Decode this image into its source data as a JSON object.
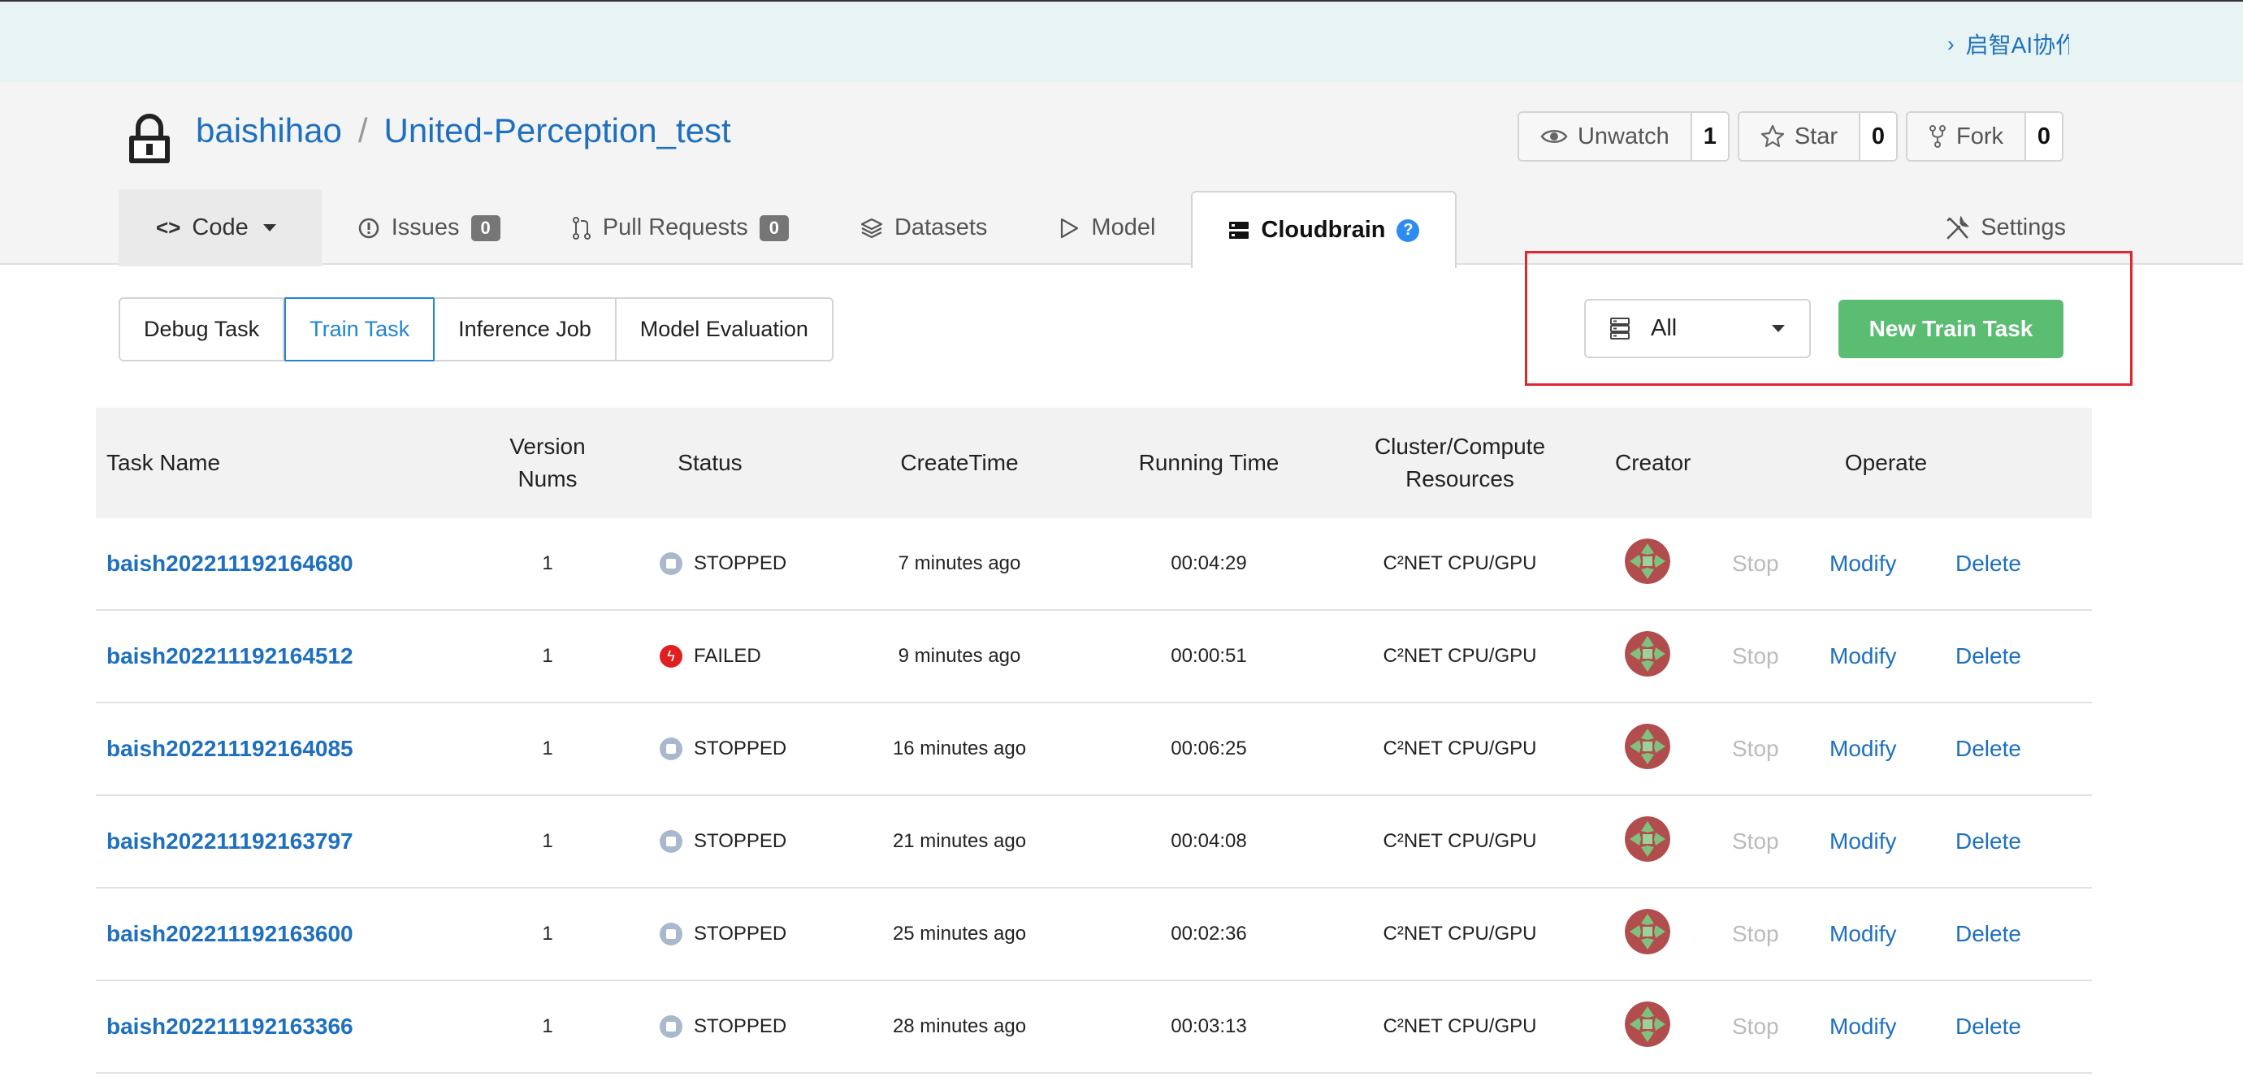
{
  "banner": {
    "link_text": "启智AI协作平台"
  },
  "repo": {
    "owner": "baishihao",
    "separator": "/",
    "name": "United-Perception_test"
  },
  "actions": {
    "watch": {
      "label": "Unwatch",
      "count": "1"
    },
    "star": {
      "label": "Star",
      "count": "0"
    },
    "fork": {
      "label": "Fork",
      "count": "0"
    }
  },
  "tabs": {
    "code": "Code",
    "issues": {
      "label": "Issues",
      "count": "0"
    },
    "pulls": {
      "label": "Pull Requests",
      "count": "0"
    },
    "datasets": "Datasets",
    "model": "Model",
    "cloudbrain": "Cloudbrain",
    "help": "?",
    "settings": "Settings"
  },
  "subtabs": [
    "Debug Task",
    "Train Task",
    "Inference Job",
    "Model Evaluation"
  ],
  "filter": {
    "selected": "All"
  },
  "new_task_label": "New Train Task",
  "table": {
    "headers": {
      "name": "Task Name",
      "version_1": "Version",
      "version_2": "Nums",
      "status": "Status",
      "create": "CreateTime",
      "running": "Running Time",
      "cluster_1": "Cluster/Compute",
      "cluster_2": "Resources",
      "creator": "Creator",
      "operate": "Operate"
    },
    "rows": [
      {
        "name": "baish202211192164680",
        "version": "1",
        "status": "STOPPED",
        "create": "7 minutes ago",
        "running": "00:04:29",
        "cluster": "C²NET CPU/GPU",
        "stop": "Stop",
        "modify": "Modify",
        "delete": "Delete"
      },
      {
        "name": "baish202211192164512",
        "version": "1",
        "status": "FAILED",
        "create": "9 minutes ago",
        "running": "00:00:51",
        "cluster": "C²NET CPU/GPU",
        "stop": "Stop",
        "modify": "Modify",
        "delete": "Delete"
      },
      {
        "name": "baish202211192164085",
        "version": "1",
        "status": "STOPPED",
        "create": "16 minutes ago",
        "running": "00:06:25",
        "cluster": "C²NET CPU/GPU",
        "stop": "Stop",
        "modify": "Modify",
        "delete": "Delete"
      },
      {
        "name": "baish202211192163797",
        "version": "1",
        "status": "STOPPED",
        "create": "21 minutes ago",
        "running": "00:04:08",
        "cluster": "C²NET CPU/GPU",
        "stop": "Stop",
        "modify": "Modify",
        "delete": "Delete"
      },
      {
        "name": "baish202211192163600",
        "version": "1",
        "status": "STOPPED",
        "create": "25 minutes ago",
        "running": "00:02:36",
        "cluster": "C²NET CPU/GPU",
        "stop": "Stop",
        "modify": "Modify",
        "delete": "Delete"
      },
      {
        "name": "baish202211192163366",
        "version": "1",
        "status": "STOPPED",
        "create": "28 minutes ago",
        "running": "00:03:13",
        "cluster": "C²NET CPU/GPU",
        "stop": "Stop",
        "modify": "Modify",
        "delete": "Delete"
      }
    ]
  },
  "colors": {
    "link": "#1e70bf",
    "primary_green": "#5bbd72",
    "highlight_red": "#e0262e",
    "failed_red": "#e02020"
  },
  "icons": {
    "lock": "lock-icon",
    "eye": "eye-icon",
    "star": "star-icon",
    "fork": "fork-icon",
    "code": "code-icon",
    "issue": "issue-icon",
    "pull": "pull-request-icon",
    "dataset": "layers-icon",
    "model": "play-icon",
    "cloudbrain": "server-icon",
    "settings": "tools-icon",
    "filter": "server-icon"
  }
}
